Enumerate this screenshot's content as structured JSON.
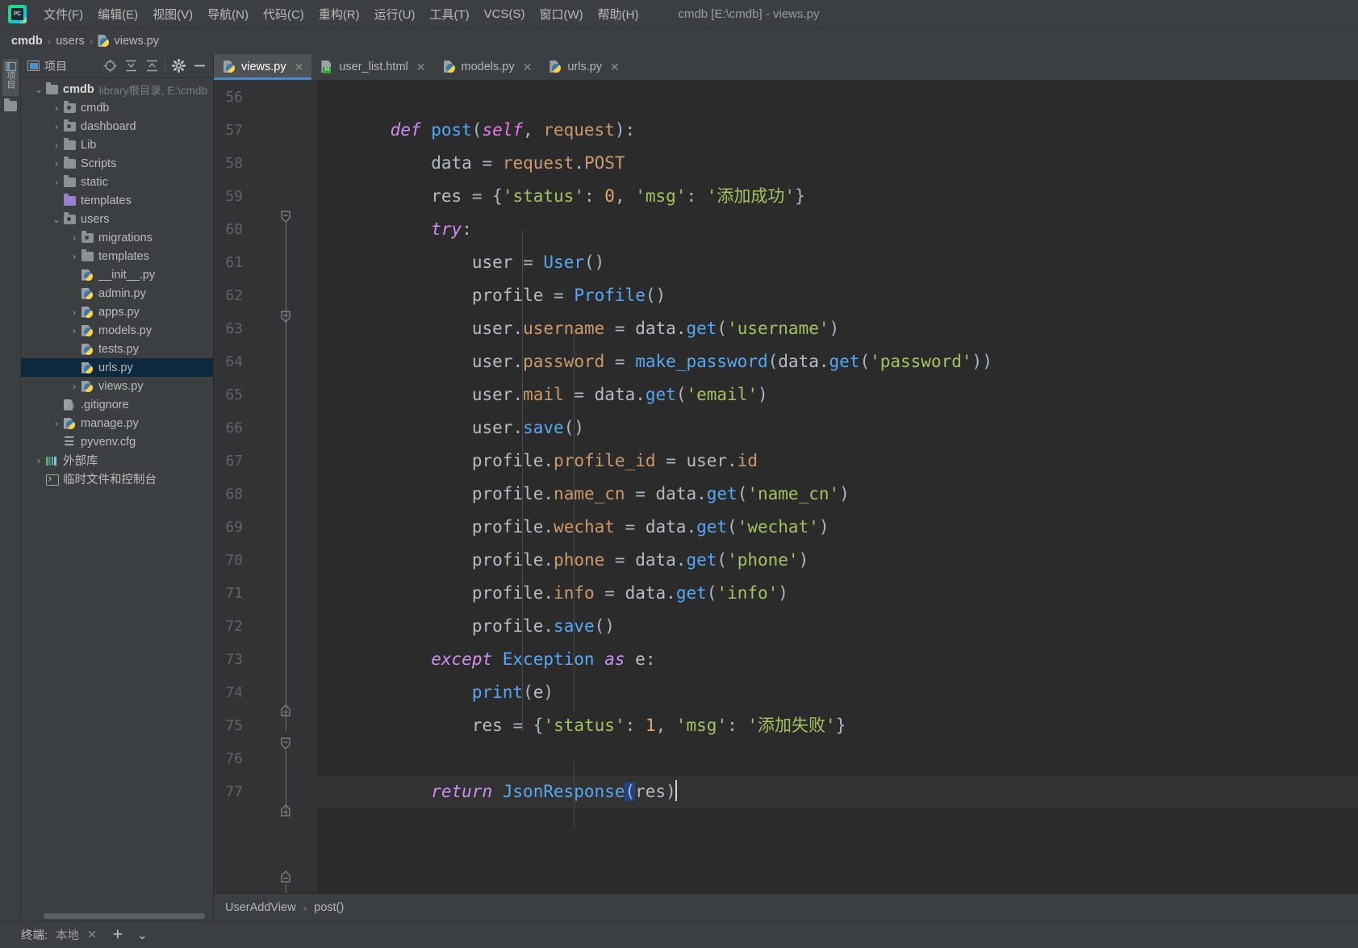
{
  "window": {
    "title": "cmdb [E:\\cmdb] - views.py"
  },
  "menubar": {
    "logo_text": "PC",
    "items": [
      {
        "label": "文件(F)",
        "mnemonic": "F"
      },
      {
        "label": "编辑(E)",
        "mnemonic": "E"
      },
      {
        "label": "视图(V)",
        "mnemonic": "V"
      },
      {
        "label": "导航(N)",
        "mnemonic": "N"
      },
      {
        "label": "代码(C)",
        "mnemonic": "C"
      },
      {
        "label": "重构(R)",
        "mnemonic": "R"
      },
      {
        "label": "运行(U)",
        "mnemonic": "U"
      },
      {
        "label": "工具(T)",
        "mnemonic": "T"
      },
      {
        "label": "VCS(S)",
        "mnemonic": "S"
      },
      {
        "label": "窗口(W)",
        "mnemonic": "W"
      },
      {
        "label": "帮助(H)",
        "mnemonic": "H"
      }
    ]
  },
  "navbar": {
    "crumbs": [
      "cmdb",
      "users",
      "views.py"
    ]
  },
  "project_panel": {
    "vertical_tab_label": "项目",
    "title": "项目",
    "toolbar_icons": [
      "locate-icon",
      "expand-all-icon",
      "collapse-all-icon",
      "settings-gear-icon",
      "hide-icon"
    ],
    "tree": [
      {
        "label": "cmdb",
        "note": "library根目录, E:\\cmdb",
        "icon": "folder-icon",
        "depth": 0,
        "arrow": "down",
        "bold": true,
        "selected": false
      },
      {
        "label": "cmdb",
        "note": "",
        "icon": "module-folder-icon",
        "depth": 1,
        "arrow": "right",
        "bold": false,
        "selected": false
      },
      {
        "label": "dashboard",
        "note": "",
        "icon": "module-folder-icon",
        "depth": 1,
        "arrow": "right",
        "bold": false,
        "selected": false
      },
      {
        "label": "Lib",
        "note": "",
        "icon": "folder-icon",
        "depth": 1,
        "arrow": "right",
        "bold": false,
        "selected": false
      },
      {
        "label": "Scripts",
        "note": "",
        "icon": "folder-icon",
        "depth": 1,
        "arrow": "right",
        "bold": false,
        "selected": false
      },
      {
        "label": "static",
        "note": "",
        "icon": "folder-icon",
        "depth": 1,
        "arrow": "right",
        "bold": false,
        "selected": false
      },
      {
        "label": "templates",
        "note": "",
        "icon": "template-folder-icon",
        "depth": 1,
        "arrow": "none",
        "bold": false,
        "selected": false
      },
      {
        "label": "users",
        "note": "",
        "icon": "module-folder-icon",
        "depth": 1,
        "arrow": "down",
        "bold": false,
        "selected": false
      },
      {
        "label": "migrations",
        "note": "",
        "icon": "module-folder-icon",
        "depth": 2,
        "arrow": "right",
        "bold": false,
        "selected": false
      },
      {
        "label": "templates",
        "note": "",
        "icon": "folder-icon",
        "depth": 2,
        "arrow": "right",
        "bold": false,
        "selected": false
      },
      {
        "label": "__init__.py",
        "note": "",
        "icon": "python-file-icon",
        "depth": 2,
        "arrow": "none",
        "bold": false,
        "selected": false
      },
      {
        "label": "admin.py",
        "note": "",
        "icon": "python-file-icon",
        "depth": 2,
        "arrow": "none",
        "bold": false,
        "selected": false
      },
      {
        "label": "apps.py",
        "note": "",
        "icon": "python-file-icon",
        "depth": 2,
        "arrow": "right",
        "bold": false,
        "selected": false
      },
      {
        "label": "models.py",
        "note": "",
        "icon": "python-file-icon",
        "depth": 2,
        "arrow": "right",
        "bold": false,
        "selected": false
      },
      {
        "label": "tests.py",
        "note": "",
        "icon": "python-file-icon",
        "depth": 2,
        "arrow": "none",
        "bold": false,
        "selected": false
      },
      {
        "label": "urls.py",
        "note": "",
        "icon": "python-file-icon",
        "depth": 2,
        "arrow": "none",
        "bold": false,
        "selected": true
      },
      {
        "label": "views.py",
        "note": "",
        "icon": "python-file-icon",
        "depth": 2,
        "arrow": "right",
        "bold": false,
        "selected": false
      },
      {
        "label": ".gitignore",
        "note": "",
        "icon": "gitignore-file-icon",
        "depth": 1,
        "arrow": "none",
        "bold": false,
        "selected": false
      },
      {
        "label": "manage.py",
        "note": "",
        "icon": "python-file-icon",
        "depth": 1,
        "arrow": "right",
        "bold": false,
        "selected": false
      },
      {
        "label": "pyvenv.cfg",
        "note": "",
        "icon": "config-file-icon",
        "depth": 1,
        "arrow": "none",
        "bold": false,
        "selected": false
      },
      {
        "label": "外部库",
        "note": "",
        "icon": "external-libraries-icon",
        "depth": 0,
        "arrow": "right",
        "bold": false,
        "selected": false
      },
      {
        "label": "临时文件和控制台",
        "note": "",
        "icon": "scratches-console-icon",
        "depth": 0,
        "arrow": "none",
        "bold": false,
        "selected": false
      }
    ]
  },
  "editor": {
    "tabs": [
      {
        "label": "views.py",
        "icon": "python-file-icon",
        "active": true
      },
      {
        "label": "user_list.html",
        "icon": "html-file-icon",
        "active": false
      },
      {
        "label": "models.py",
        "icon": "python-file-icon",
        "active": false
      },
      {
        "label": "urls.py",
        "icon": "python-file-icon",
        "active": false
      }
    ],
    "first_line_number": 56,
    "line_numbers": [
      56,
      57,
      58,
      59,
      60,
      61,
      62,
      63,
      64,
      65,
      66,
      67,
      68,
      69,
      70,
      71,
      72,
      73,
      74,
      75,
      76,
      77
    ],
    "lines": [
      "",
      "    def post(self, request):",
      "        data = request.POST",
      "        res = {'status': 0, 'msg': '添加成功'}",
      "        try:",
      "            user = User()",
      "            profile = Profile()",
      "            user.username = data.get('username')",
      "            user.password = make_password(data.get('password'))",
      "            user.mail = data.get('email')",
      "            user.save()",
      "            profile.profile_id = user.id",
      "            profile.name_cn = data.get('name_cn')",
      "            profile.wechat = data.get('wechat')",
      "            profile.phone = data.get('phone')",
      "            profile.info = data.get('info')",
      "            profile.save()",
      "        except Exception as e:",
      "            print(e)",
      "            res = {'status': 1, 'msg': '添加失败'}",
      "",
      "        return JsonResponse(res)"
    ],
    "cursor_line": 77,
    "breadcrumb": {
      "class": "UserAddView",
      "method": "post()"
    }
  },
  "bottom_bar": {
    "tool_label": "终端:",
    "session_name": "本地",
    "close_icon": "close-icon",
    "add_icon": "plus-icon",
    "dropdown_icon": "chevron-down-icon"
  },
  "colors": {
    "panel_bg": "#3c3f41",
    "editor_bg": "#2b2b2b",
    "gutter_bg": "#313335",
    "accent": "#4a88c7",
    "selection": "#0d293e",
    "keyword": "#cf8ef2",
    "string": "#a5c261",
    "number": "#e8a76a",
    "function": "#56a8f5"
  }
}
